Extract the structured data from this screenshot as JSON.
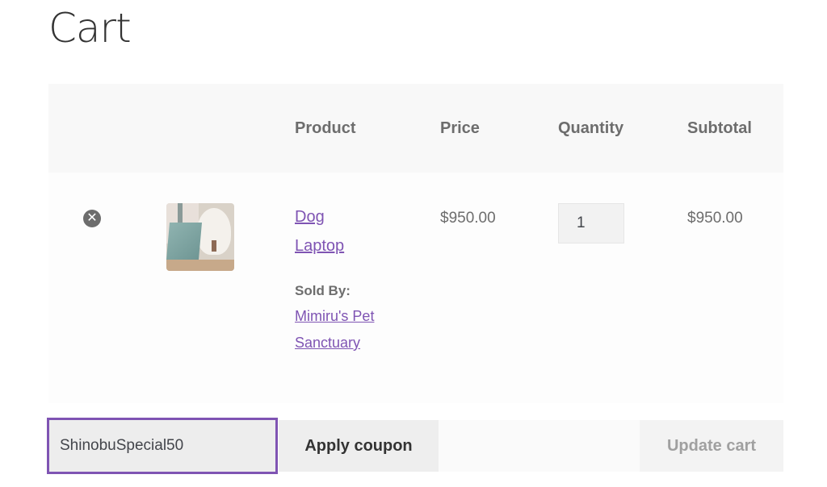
{
  "page": {
    "title": "Cart"
  },
  "table": {
    "headers": [
      "",
      "",
      "Product",
      "Price",
      "Quantity",
      "Subtotal"
    ],
    "items": [
      {
        "remove_icon": "remove-circle-x",
        "thumbnail_alt": "Dog Laptop",
        "product_name_line1": "Dog",
        "product_name_line2": "Laptop",
        "sold_by_label": "Sold By:",
        "vendor_line1": "Mimiru's Pet",
        "vendor_line2": "Sanctuary",
        "price": "$950.00",
        "quantity": "1",
        "subtotal": "$950.00"
      }
    ]
  },
  "actions": {
    "coupon_value": "ShinobuSpecial50",
    "apply_coupon_label": "Apply coupon",
    "update_cart_label": "Update cart"
  },
  "colors": {
    "accent": "#7f54b3",
    "text": "#6d6d6d",
    "heading": "#333333"
  }
}
